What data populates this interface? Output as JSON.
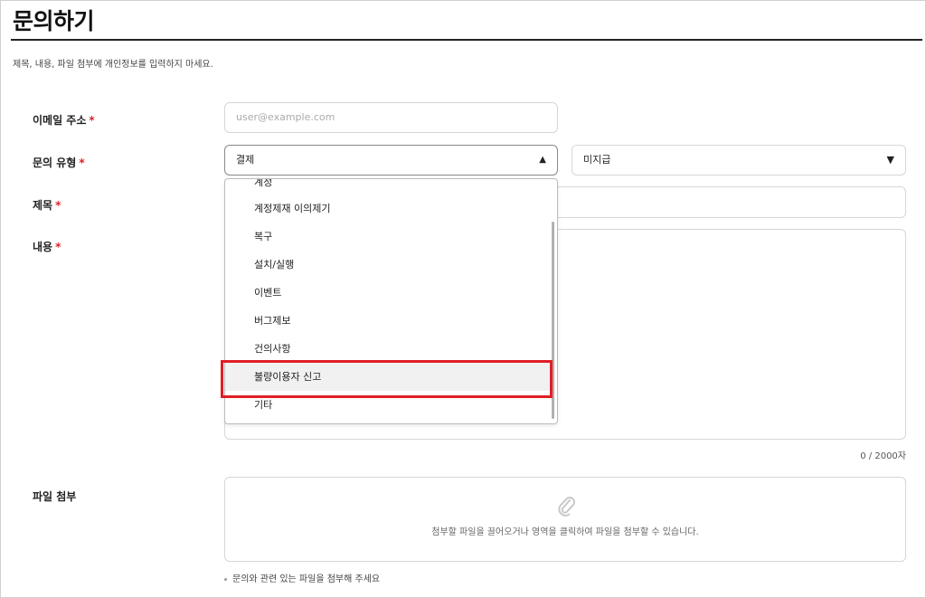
{
  "page": {
    "title": "문의하기",
    "notice": "제목, 내용, 파일 첨부에 개인정보를 입력하지 마세요."
  },
  "form": {
    "email_label": "이메일 주소",
    "email_placeholder": "user@example.com",
    "type_label": "문의 유형",
    "type_value": "결제",
    "subtype_value": "미지급",
    "subject_label": "제목",
    "content_label": "내용",
    "required_mark": "*",
    "char_counter": "0 / 2000자",
    "attach_label": "파일 첨부",
    "attach_hint": "첨부할 파일을 끌어오거나 영역을 클릭하여 파일을 첨부할 수 있습니다.",
    "attach_note": "문의와 관련 있는 파일을 첨부해 주세요"
  },
  "dropdown": {
    "items": [
      {
        "label": "계정"
      },
      {
        "label": "계정제재 이의제기"
      },
      {
        "label": "복구"
      },
      {
        "label": "설치/실행"
      },
      {
        "label": "이벤트"
      },
      {
        "label": "버그제보"
      },
      {
        "label": "건의사항"
      },
      {
        "label": "불량이용자 신고"
      },
      {
        "label": "기타"
      }
    ],
    "highlighted_index": 7
  },
  "icons": {
    "caret_up": "caret-up-icon",
    "caret_down": "caret-down-icon",
    "attach": "paperclip-icon"
  },
  "colors": {
    "required": "#e02020",
    "highlight_box": "#e01e26"
  }
}
